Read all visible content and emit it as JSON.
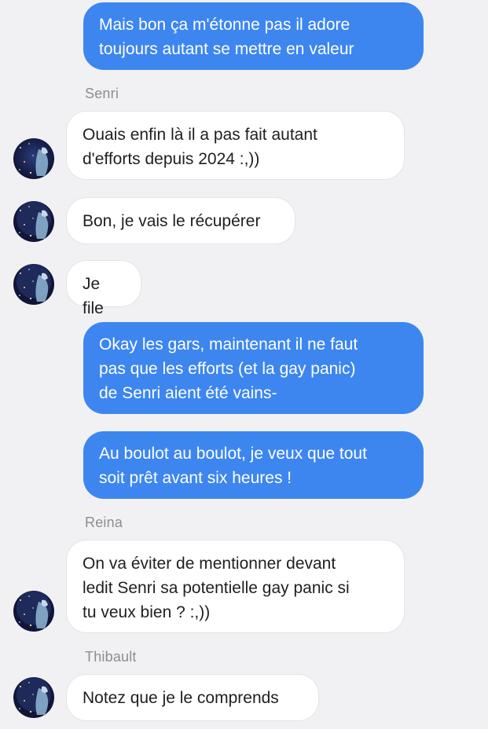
{
  "messages": [
    {
      "kind": "outgoing",
      "text": "Mais bon ça m'étonne pas il adore\ntoujours autant se mettre en valeur"
    },
    {
      "kind": "sender",
      "text": "Senri"
    },
    {
      "kind": "incoming",
      "text": "Ouais enfin là il a pas fait autant\nd'efforts depuis 2024 :,))"
    },
    {
      "kind": "incoming",
      "text": "Bon, je vais le récupérer"
    },
    {
      "kind": "incoming",
      "text": "Je file"
    },
    {
      "kind": "outgoing",
      "text": "Okay les gars, maintenant il ne faut\npas que les efforts (et la gay panic)\nde Senri aient été vains-"
    },
    {
      "kind": "outgoing",
      "text": "Au boulot au boulot, je veux que tout\nsoit prêt avant six heures !"
    },
    {
      "kind": "sender",
      "text": "Reina"
    },
    {
      "kind": "incoming",
      "text": "On va éviter de mentionner devant\nledit Senri sa potentielle gay panic si\ntu veux bien ? :,))"
    },
    {
      "kind": "sender",
      "text": "Thibault"
    },
    {
      "kind": "incoming",
      "text": "Notez que je le comprends"
    }
  ],
  "colors": {
    "background": "#f1f1f4",
    "outgoing_bubble": "#3d86f0",
    "incoming_bubble": "#ffffff",
    "sender_name": "#8c8c94"
  },
  "icons": {
    "avatar": "starry-night-avatar-icon"
  }
}
